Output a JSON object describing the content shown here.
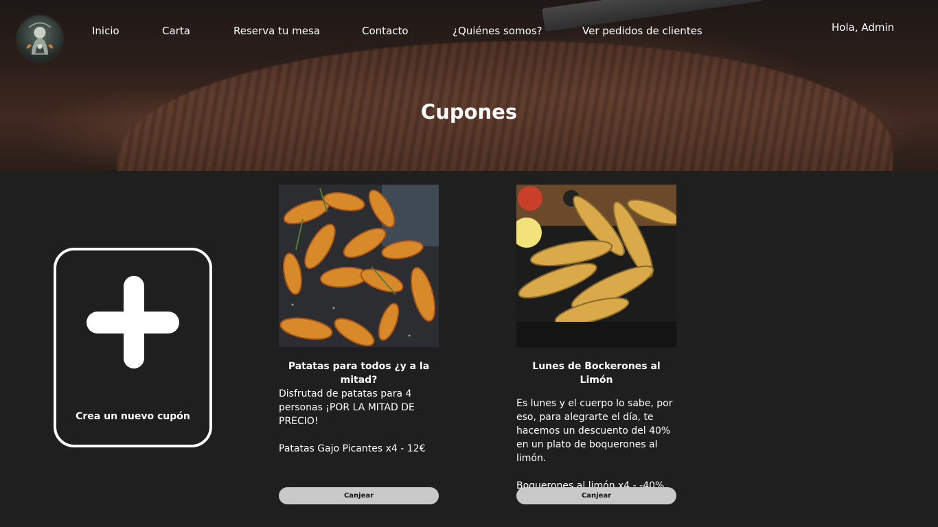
{
  "nav": {
    "items": [
      {
        "label": "Inicio"
      },
      {
        "label": "Carta"
      },
      {
        "label": "Reserva tu mesa"
      },
      {
        "label": "Contacto"
      },
      {
        "label": "¿Quiénes somos?"
      },
      {
        "label": "Ver pedidos de clientes"
      }
    ],
    "greeting": "Hola, Admin"
  },
  "hero": {
    "title": "Cupones"
  },
  "new_coupon": {
    "label": "Crea un nuevo cupón",
    "icon": "plus-icon"
  },
  "coupons": [
    {
      "title": "Patatas para todos ¿y a la mitad?",
      "description": "Disfrutad de patatas para 4 personas ¡POR LA MITAD DE PRECIO!",
      "price_line": "Patatas Gajo Picantes x4 - 12€",
      "button": "Canjear",
      "image": "potato-wedges-photo"
    },
    {
      "title": "Lunes de Bockerones al Limón",
      "description": "Es lunes y el cuerpo lo sabe, por eso, para alegrarte el día, te hacemos un descuento del 40% en un plato de boquerones al limón.",
      "price_line": "Boquerones al limón x4 - -40%",
      "button": "Canjear",
      "image": "fried-anchovies-photo"
    }
  ],
  "colors": {
    "background": "#1f1f1f",
    "text": "#ffffff",
    "button_bg": "#c9c9c9",
    "button_text": "#111111"
  }
}
